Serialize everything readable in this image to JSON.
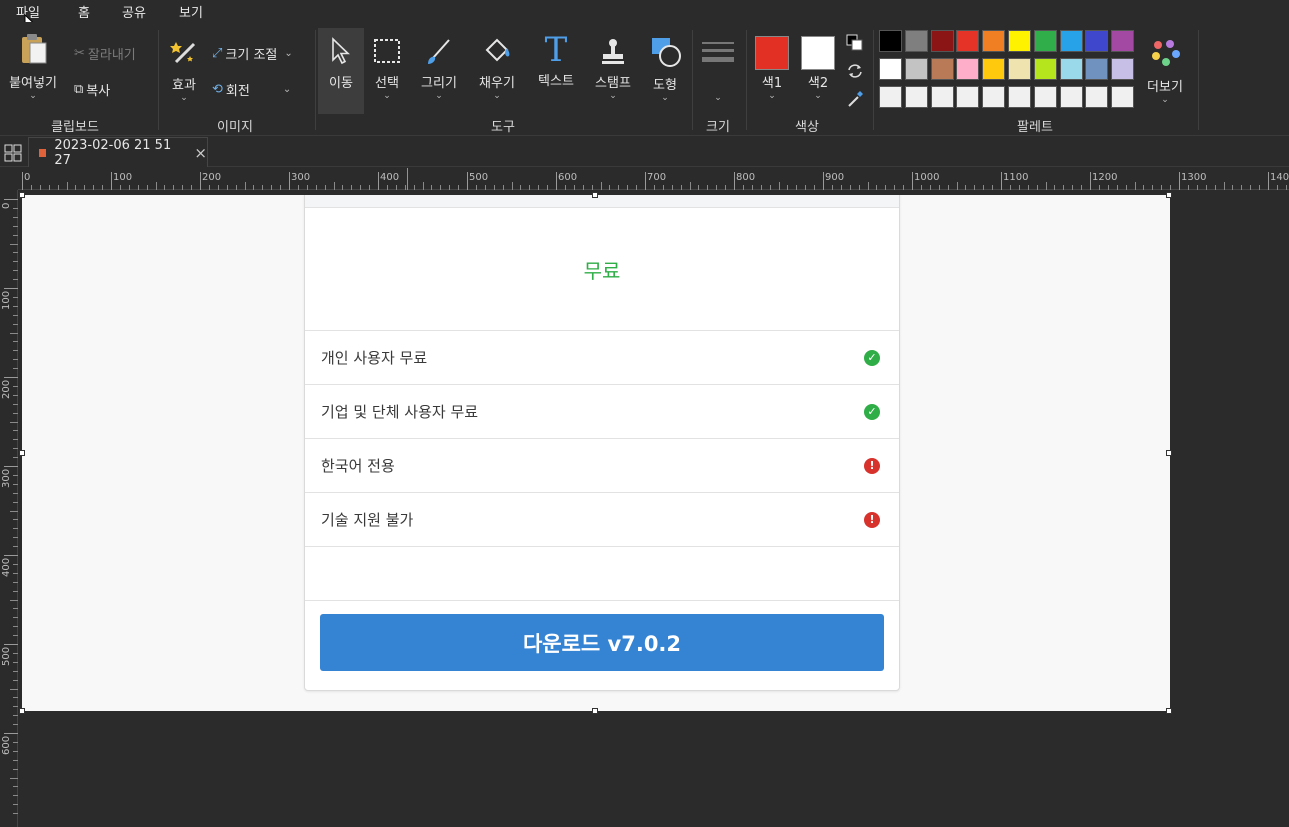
{
  "menu": [
    "파일",
    "홈",
    "공유",
    "보기"
  ],
  "clipboard": {
    "paste": "붙여넣기",
    "cut": "잘라내기",
    "copy": "복사",
    "label": "클립보드"
  },
  "image": {
    "effect": "효과",
    "resize": "크기 조절",
    "rotate": "회전",
    "label": "이미지"
  },
  "tools": {
    "move": "이동",
    "select": "선택",
    "draw": "그리기",
    "fill": "채우기",
    "text": "텍스트",
    "stamp": "스탬프",
    "shape": "도형",
    "label": "도구"
  },
  "size": {
    "label": "크기"
  },
  "colors": {
    "color1": "색1",
    "color2": "색2",
    "label": "색상",
    "color1_value": "#e33025",
    "color2_value": "#ffffff"
  },
  "palette": {
    "label": "팔레트",
    "more": "더보기",
    "row1": [
      "#000000",
      "#7f7f7f",
      "#8b1414",
      "#e53328",
      "#f07f24",
      "#fff200",
      "#2fae4a",
      "#27a2e8",
      "#3f48cc",
      "#a349a4"
    ],
    "row2": [
      "#ffffff",
      "#c3c3c3",
      "#b97a57",
      "#ffaec9",
      "#ffc90e",
      "#efe4b0",
      "#b5e61d",
      "#99d9ea",
      "#7092be",
      "#c8bfe7"
    ],
    "row3": [
      "#f0f0f0",
      "#f0f0f0",
      "#f0f0f0",
      "#f0f0f0",
      "#f0f0f0",
      "#f0f0f0",
      "#f0f0f0",
      "#f0f0f0",
      "#f0f0f0",
      "#f0f0f0"
    ]
  },
  "tab": {
    "title": "2023-02-06 21 51 27",
    "close": "×"
  },
  "ruler": {
    "h": [
      "0",
      "100",
      "200",
      "300",
      "400",
      "500",
      "600",
      "700",
      "800",
      "900",
      "1000",
      "1100",
      "1200",
      "1300",
      "140"
    ],
    "v": [
      "0",
      "100",
      "200",
      "300",
      "400",
      "500",
      "600"
    ]
  },
  "content": {
    "title": "무료",
    "features": [
      {
        "text": "개인 사용자 무료",
        "status": "ok"
      },
      {
        "text": "기업 및 단체 사용자 무료",
        "status": "ok"
      },
      {
        "text": "한국어 전용",
        "status": "warn"
      },
      {
        "text": "기술 지원 불가",
        "status": "warn"
      }
    ],
    "download": "다운로드 v7.0.2"
  }
}
